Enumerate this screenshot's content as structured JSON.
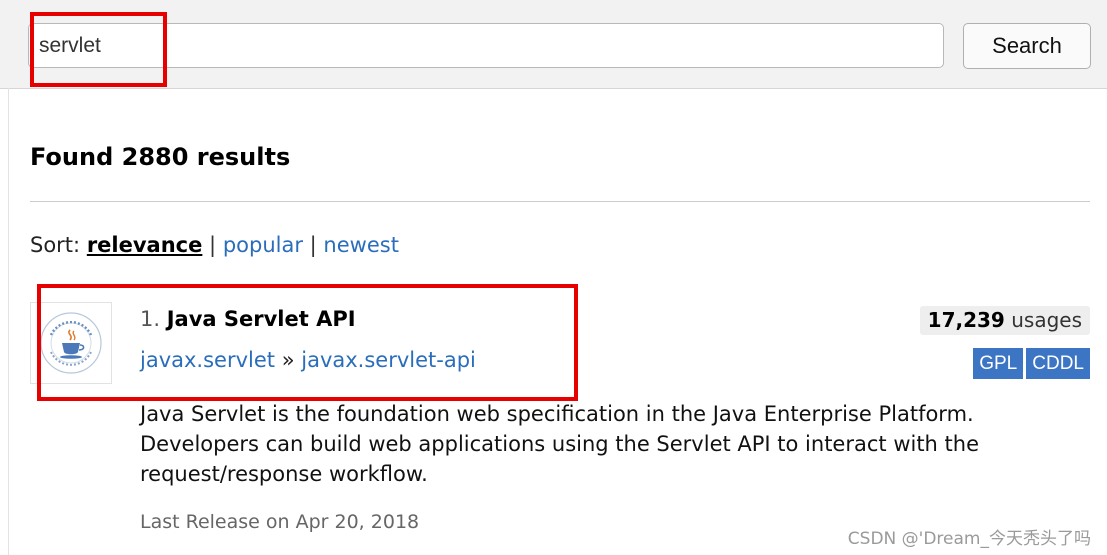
{
  "search": {
    "value": "servlet",
    "button_label": "Search"
  },
  "results_heading": "Found 2880 results",
  "sort": {
    "label": "Sort:",
    "active": "relevance",
    "options": [
      "popular",
      "newest"
    ],
    "separator": "|"
  },
  "result": {
    "number": "1.",
    "title": "Java Servlet API",
    "group": "javax.servlet",
    "coord_separator": "»",
    "artifact": "javax.servlet-api",
    "usages_count": "17,239",
    "usages_label": "usages",
    "licenses": [
      "GPL",
      "CDDL"
    ],
    "description": "Java Servlet is the foundation web specification in the Java Enterprise Platform. Developers can build web applications using the Servlet API to interact with the request/response workflow.",
    "last_release": "Last Release on Apr 20, 2018",
    "logo_icon": "java-community-process-logo-icon"
  },
  "watermark": "CSDN @'Dream_今天秃头了吗",
  "colors": {
    "link": "#2a6ebb",
    "license_badge": "#3b75c4",
    "highlight": "#e60000",
    "topbar": "#f2f2f2"
  }
}
